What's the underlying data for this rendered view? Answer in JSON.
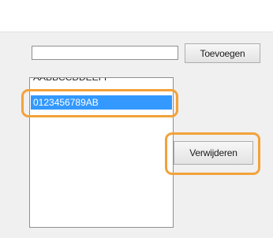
{
  "form": {
    "address_value": "",
    "add_label": "Toevoegen",
    "remove_label": "Verwijderen"
  },
  "list": {
    "items": [
      {
        "label": "AABBCCDDEEFF"
      },
      {
        "label": "0123456789AB"
      }
    ],
    "selected_index": 1
  },
  "colors": {
    "highlight": "#f2a23a",
    "selection": "#3399ff"
  }
}
